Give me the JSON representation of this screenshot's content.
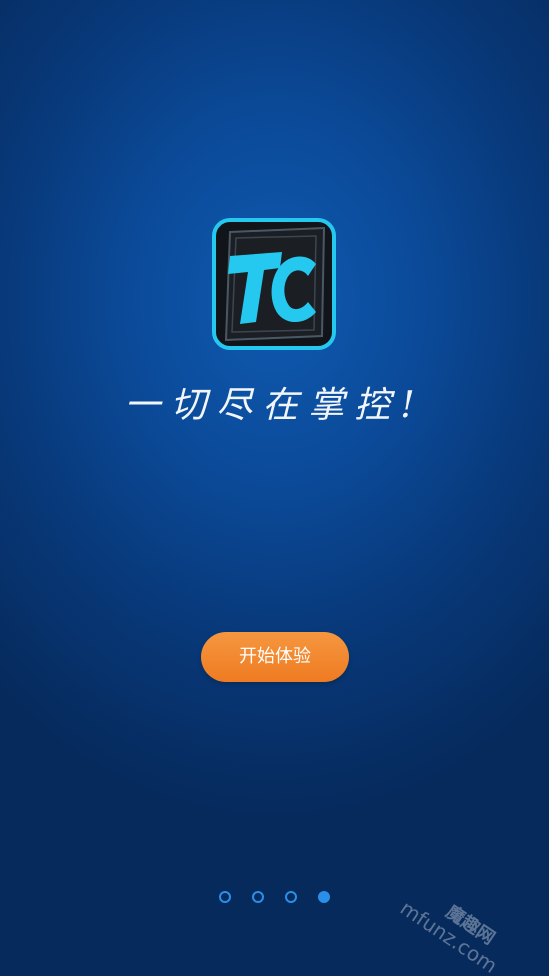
{
  "logo": {
    "icon": "tc-logo-icon",
    "letters": "TC",
    "accent_color": "#25c9f0"
  },
  "slogan": "一切尽在掌控!",
  "start_button": {
    "label": "开始体验",
    "color": "#ef7b22"
  },
  "pager": {
    "total": 4,
    "active_index": 3,
    "color": "#2a8fe8"
  },
  "watermark": {
    "cn": "魔趣网",
    "en": "mfunz.com"
  }
}
